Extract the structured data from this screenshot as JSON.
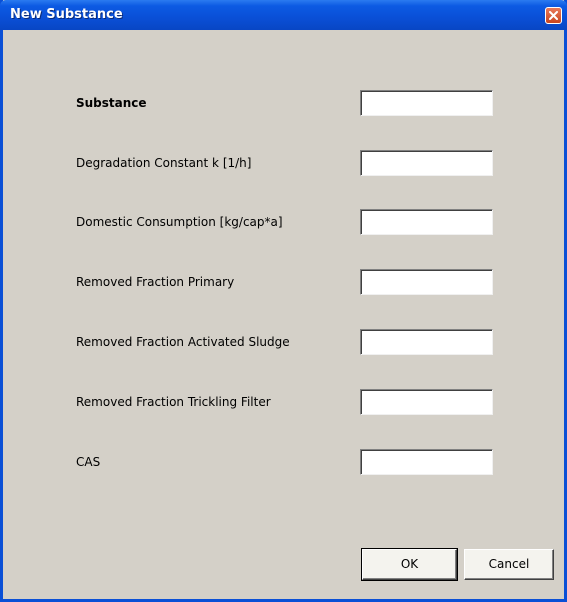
{
  "window": {
    "title": "New Substance"
  },
  "form": {
    "fields": [
      {
        "label": "Substance",
        "value": ""
      },
      {
        "label": "Degradation Constant k [1/h]",
        "value": ""
      },
      {
        "label": "Domestic Consumption [kg/cap*a]",
        "value": ""
      },
      {
        "label": "Removed Fraction Primary",
        "value": ""
      },
      {
        "label": "Removed Fraction Activated Sludge",
        "value": ""
      },
      {
        "label": "Removed Fraction Trickling Filter",
        "value": ""
      },
      {
        "label": "CAS",
        "value": ""
      }
    ]
  },
  "buttons": {
    "ok_label": "OK",
    "cancel_label": "Cancel"
  },
  "icons": {
    "close": "close-icon"
  },
  "colors": {
    "titlebar": "#0a4fd6",
    "dialog_bg": "#d4d0c8",
    "close_button": "#c9451f"
  }
}
